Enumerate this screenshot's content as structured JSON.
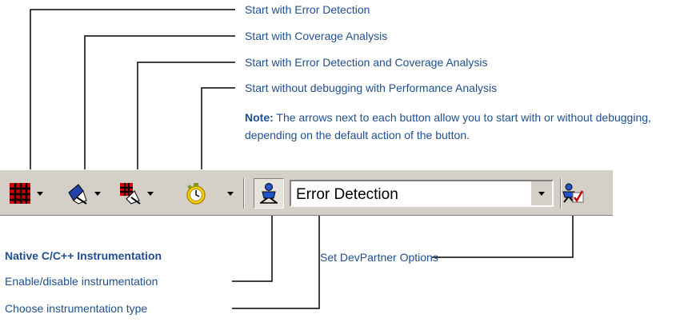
{
  "callouts": {
    "error_detection": "Start with Error Detection",
    "coverage": "Start with Coverage Analysis",
    "error_and_coverage": "Start with Error Detection and Coverage Analysis",
    "performance": "Start without debugging with Performance Analysis"
  },
  "note": {
    "label": "Note:",
    "text": " The arrows next to each button allow you to start with or without debugging, depending on the default action of the button."
  },
  "toolbar": {
    "buttons": [
      {
        "icon": "error-detection-icon"
      },
      {
        "icon": "coverage-analysis-icon"
      },
      {
        "icon": "error-coverage-icon"
      },
      {
        "icon": "performance-stopwatch-icon"
      }
    ],
    "instrumentation_toggle_icon": "instrumentation-toggle-icon",
    "instrumentation_type": "Error Detection",
    "options_icon": "devpartner-options-icon"
  },
  "bottom_labels": {
    "section_title": "Native C/C++ Instrumentation",
    "enable_disable": "Enable/disable instrumentation",
    "choose_type": "Choose instrumentation type",
    "options": "Set DevPartner Options"
  },
  "colors": {
    "callout_text": "#1f4f8f",
    "toolbar_bg": "#d4d0c8"
  }
}
